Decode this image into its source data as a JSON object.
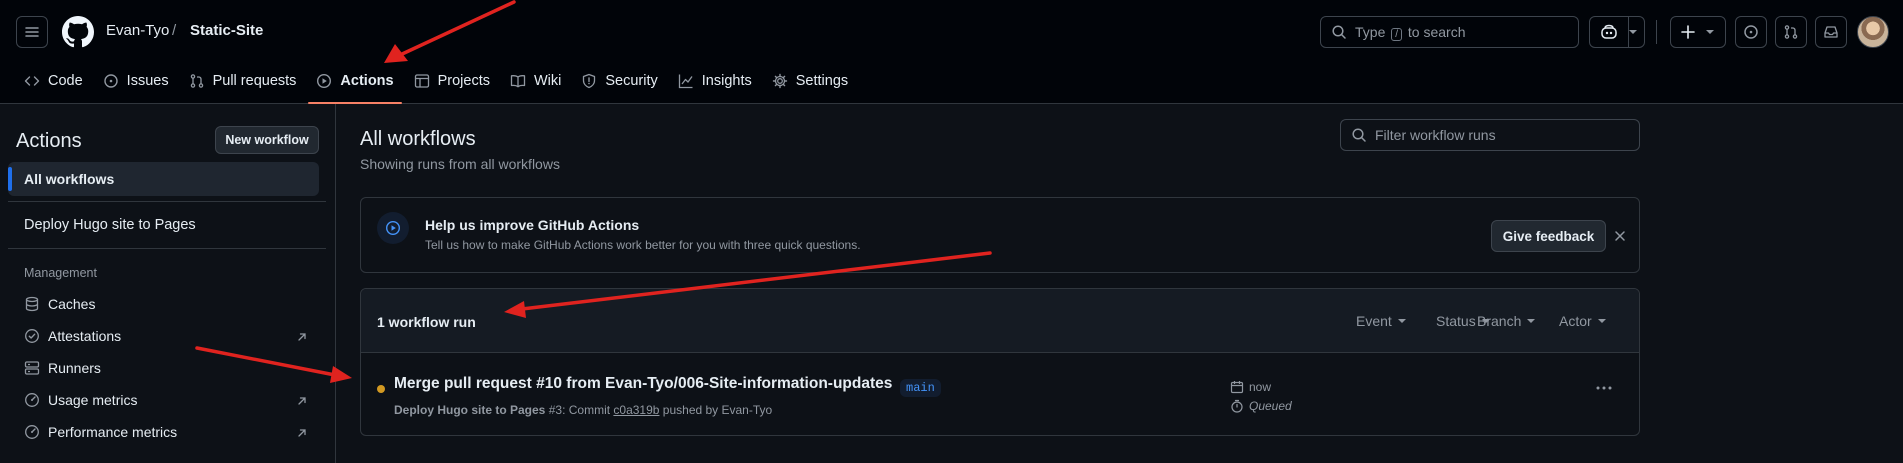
{
  "header": {
    "owner": "Evan-Tyo",
    "separator": "/",
    "repo": "Static-Site",
    "search_prefix": "Type",
    "search_key": "/",
    "search_suffix": "to search"
  },
  "tabs": [
    {
      "label": "Code",
      "icon": "code-icon"
    },
    {
      "label": "Issues",
      "icon": "issue-icon"
    },
    {
      "label": "Pull requests",
      "icon": "pull-request-icon"
    },
    {
      "label": "Actions",
      "icon": "play-icon",
      "active": true
    },
    {
      "label": "Projects",
      "icon": "table-icon"
    },
    {
      "label": "Wiki",
      "icon": "book-icon"
    },
    {
      "label": "Security",
      "icon": "shield-icon"
    },
    {
      "label": "Insights",
      "icon": "graph-icon"
    },
    {
      "label": "Settings",
      "icon": "gear-icon"
    }
  ],
  "sidebar": {
    "title": "Actions",
    "new_workflow": "New workflow",
    "all_workflows": "All workflows",
    "workflow": "Deploy Hugo site to Pages",
    "management_heading": "Management",
    "management": [
      {
        "label": "Caches",
        "icon": "database-icon",
        "external": false
      },
      {
        "label": "Attestations",
        "icon": "verified-icon",
        "external": true
      },
      {
        "label": "Runners",
        "icon": "server-icon",
        "external": false
      },
      {
        "label": "Usage metrics",
        "icon": "meter-icon",
        "external": true
      },
      {
        "label": "Performance metrics",
        "icon": "meter-icon",
        "external": true
      }
    ]
  },
  "main": {
    "title": "All workflows",
    "subtitle": "Showing runs from all workflows",
    "filter_placeholder": "Filter workflow runs",
    "banner": {
      "title": "Help us improve GitHub Actions",
      "text": "Tell us how to make GitHub Actions work better for you with three quick questions.",
      "feedback": "Give feedback"
    },
    "runs_count": "1 workflow run",
    "filters": [
      "Event",
      "Status",
      "Branch",
      "Actor"
    ],
    "run": {
      "title": "Merge pull request #10 from Evan-Tyo/006-Site-information-updates",
      "workflow": "Deploy Hugo site to Pages",
      "number": "#3",
      "commit_prefix": ": Commit",
      "commit": "c0a319b",
      "pushed_by": "pushed by Evan-Tyo",
      "branch": "main",
      "time": "now",
      "status": "Queued"
    }
  },
  "colors": {
    "background": "#0d1117",
    "header": "#010409",
    "accent_tab": "#f78166",
    "queued": "#d29922",
    "annotation_arrow": "#e0231f"
  }
}
